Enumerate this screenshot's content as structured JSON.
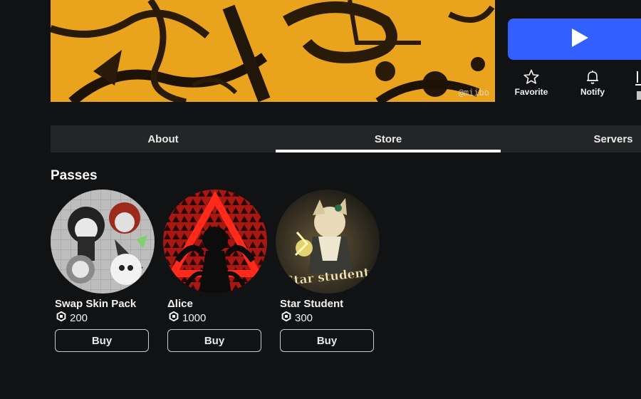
{
  "banner": {
    "watermark": "@miibo"
  },
  "actions": {
    "favorite_label": "Favorite",
    "notify_label": "Notify"
  },
  "tabs": [
    {
      "label": "About",
      "active": false
    },
    {
      "label": "Store",
      "active": true
    },
    {
      "label": "Servers",
      "active": false
    }
  ],
  "passes": {
    "title": "Passes",
    "items": [
      {
        "name": "Swap Skin Pack",
        "price": "200",
        "buy_label": "Buy"
      },
      {
        "name": "Δlice",
        "price": "1000",
        "buy_label": "Buy"
      },
      {
        "name": "Star Student",
        "price": "300",
        "buy_label": "Buy",
        "thumb_text": "Star student"
      }
    ]
  },
  "colors": {
    "background": "#111214",
    "play_button": "#335fff",
    "tab_bar": "#232527",
    "banner": "#e8a21a"
  }
}
